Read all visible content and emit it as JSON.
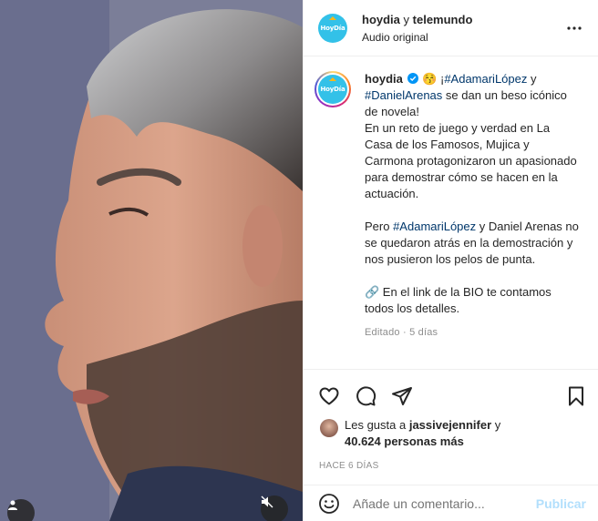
{
  "header": {
    "account": "hoydia",
    "joiner": "y",
    "collaborator": "telemundo",
    "audio": "Audio original"
  },
  "caption": {
    "username": "hoydia",
    "emoji": "😚",
    "lines_1": [
      "¡",
      "#AdamariLópez",
      " y"
    ],
    "tag1": "#AdamariLópez",
    "tag2": "#DanielArenas",
    "text1a": "¡",
    "text1b": " y",
    "text1c": " se dan un beso icónico de novela!",
    "text2": "En un reto de juego y verdad en La Casa de los Famosos, Mujica y Carmona protagonizaron un apasionado para demostrar cómo se hacen en la actuación.",
    "text3a": "Pero ",
    "tag3": "#AdamariLópez",
    "text3b": " y Daniel Arenas no se quedaron atrás en la demostración y nos pusieron los pelos de punta.",
    "link_emoji": "🔗",
    "text4": " En el link de la BIO te contamos todos los detalles.",
    "edited": "Editado · 5 días"
  },
  "logo_text": "HoyDía",
  "likes": {
    "prefix": "Les gusta a ",
    "user": "jassivejennifer",
    "joiner": " y",
    "count": "40.624 personas más"
  },
  "timestamp": "HACE 6 DÍAS",
  "comment": {
    "placeholder": "Añade un comentario...",
    "post": "Publicar"
  },
  "colors": {
    "link": "#00376b",
    "verified": "#0095f6",
    "post_disabled": "#b2dffc",
    "brand": "#33c1e8"
  }
}
